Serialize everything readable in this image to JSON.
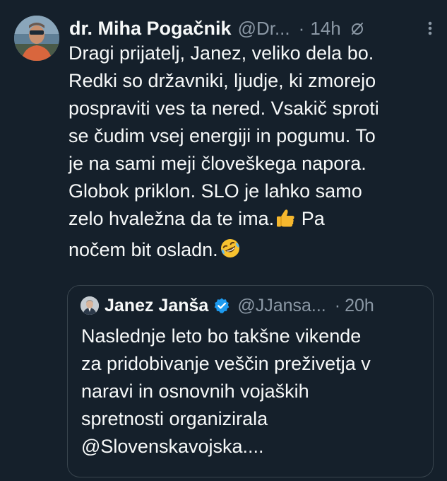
{
  "tweet": {
    "author_name": "dr. Miha Pogačnik",
    "author_handle": "@Dr...",
    "separator": "·",
    "time": "14h",
    "body_lines": [
      "Dragi prijatelj, Janez, veliko dela bo.",
      "Redki so državniki, ljudje, ki zmorejo",
      "pospraviti ves ta nered. Vsakič sproti",
      "se čudim vsej energiji in pogumu. To",
      "je na sami meji človeškega napora.",
      "Globok priklon. SLO je lahko samo"
    ],
    "body_line7_text": "zelo hvaležna da te ima.",
    "body_line7_emoji": "thumbs-up",
    "body_line7_tail": " Pa",
    "body_line8_text": "nočem bit osladn.",
    "body_line8_emoji": "rolling-on-floor-laughing"
  },
  "quote": {
    "author_name": "Janez Janša",
    "verified": true,
    "author_handle": "@JJansa...",
    "separator": "·",
    "time": "20h",
    "text": "Naslednje leto bo takšne vikende\nza pridobivanje veščin preživetja v\nnaravi in osnovnih vojaških\nspretnosti organizirala\n@Slovenskavojska...."
  },
  "colors": {
    "background": "#15202b",
    "text_primary": "#f7f9f9",
    "text_secondary": "#8b98a5",
    "border": "#38444d",
    "verified": "#1d9bf0"
  },
  "icons": [
    "edit-history-icon",
    "more-options-icon",
    "verified-badge-icon"
  ]
}
